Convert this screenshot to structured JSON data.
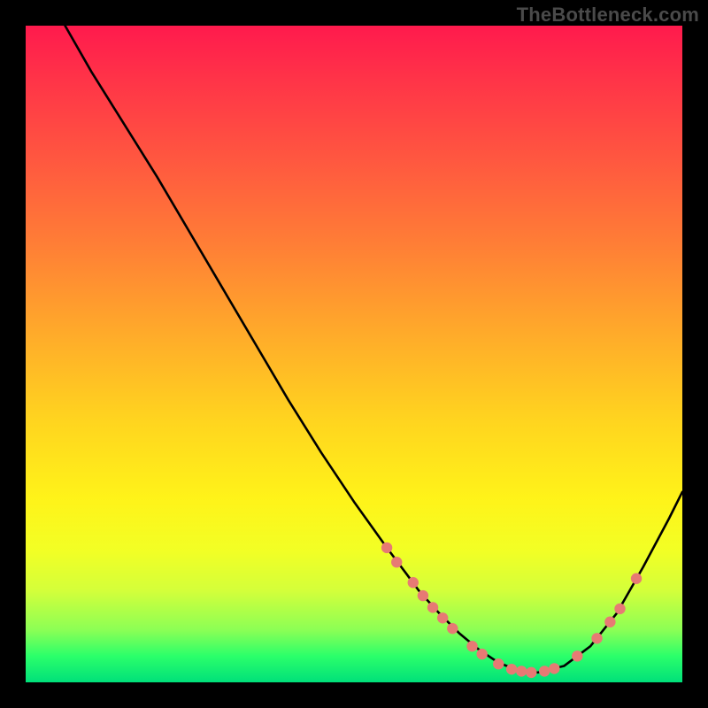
{
  "attribution": "TheBottleneck.com",
  "colors": {
    "background": "#000000",
    "gradient_top": "#ff1a4d",
    "gradient_bottom": "#00e07a",
    "curve": "#000000",
    "dot_fill": "#e77a74",
    "dot_stroke": "#c45a54"
  },
  "chart_data": {
    "type": "line",
    "title": "",
    "xlabel": "",
    "ylabel": "",
    "xlim": [
      0,
      100
    ],
    "ylim": [
      0,
      100
    ],
    "notes": "Axes are unlabeled; y is plotted with 0 at bottom and 100 at top. Values are estimated from the image. Dots mark highlighted data points on the curve.",
    "series": [
      {
        "name": "bottleneck-curve",
        "x": [
          6,
          10,
          15,
          20,
          25,
          30,
          35,
          40,
          45,
          50,
          55,
          58,
          60,
          63,
          66,
          69,
          72,
          75,
          78,
          82,
          86,
          90,
          94,
          98,
          100
        ],
        "y": [
          100,
          93,
          85,
          77,
          68.5,
          60,
          51.5,
          43,
          35,
          27.5,
          20.5,
          16.5,
          13.8,
          10.5,
          7.5,
          5,
          3,
          1.8,
          1.5,
          2.5,
          5.5,
          10.5,
          17.5,
          25,
          29
        ]
      }
    ],
    "dots": [
      {
        "x": 55,
        "y": 20.5
      },
      {
        "x": 56.5,
        "y": 18.3
      },
      {
        "x": 59,
        "y": 15.2
      },
      {
        "x": 60.5,
        "y": 13.2
      },
      {
        "x": 62,
        "y": 11.4
      },
      {
        "x": 63.5,
        "y": 9.8
      },
      {
        "x": 65,
        "y": 8.2
      },
      {
        "x": 68,
        "y": 5.5
      },
      {
        "x": 69.5,
        "y": 4.3
      },
      {
        "x": 72,
        "y": 2.8
      },
      {
        "x": 74,
        "y": 2.0
      },
      {
        "x": 75.5,
        "y": 1.7
      },
      {
        "x": 77,
        "y": 1.5
      },
      {
        "x": 79,
        "y": 1.7
      },
      {
        "x": 80.5,
        "y": 2.1
      },
      {
        "x": 84,
        "y": 4.0
      },
      {
        "x": 87,
        "y": 6.7
      },
      {
        "x": 89,
        "y": 9.2
      },
      {
        "x": 90.5,
        "y": 11.2
      },
      {
        "x": 93,
        "y": 15.8
      }
    ]
  }
}
